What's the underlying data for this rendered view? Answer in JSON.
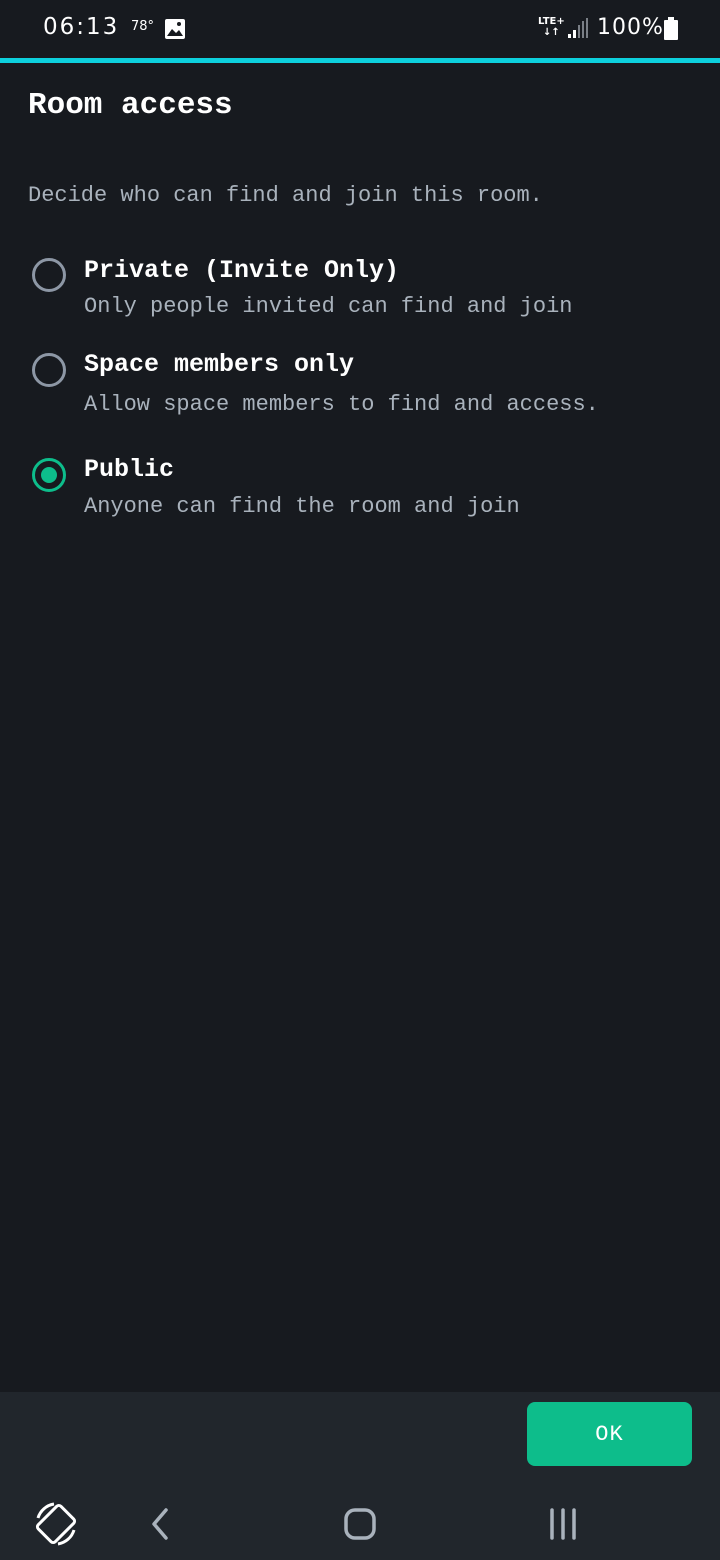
{
  "status_bar": {
    "time": "06:13",
    "temperature": "78°",
    "network": "LTE+",
    "battery": "100%"
  },
  "dialog": {
    "title": "Room access",
    "description": "Decide who can find and join this room.",
    "options": [
      {
        "label": "Private (Invite Only)",
        "sublabel": "Only people invited can find and join",
        "selected": false
      },
      {
        "label": "Space members only",
        "sublabel": "Allow space members to find and access.",
        "selected": false
      },
      {
        "label": "Public",
        "sublabel": "Anyone can find the room and join",
        "selected": true
      }
    ],
    "ok_label": "OK"
  },
  "colors": {
    "background": "#171a1f",
    "accent_line": "#0dd0dd",
    "primary_green": "#0dbd8b",
    "secondary_text": "#a9b2bc",
    "footer": "#21262c"
  },
  "icons": {
    "status": [
      "gallery-icon",
      "signal-icon",
      "battery-icon"
    ],
    "navigation": [
      "rotate-icon",
      "back-icon",
      "home-icon",
      "recents-icon"
    ]
  }
}
